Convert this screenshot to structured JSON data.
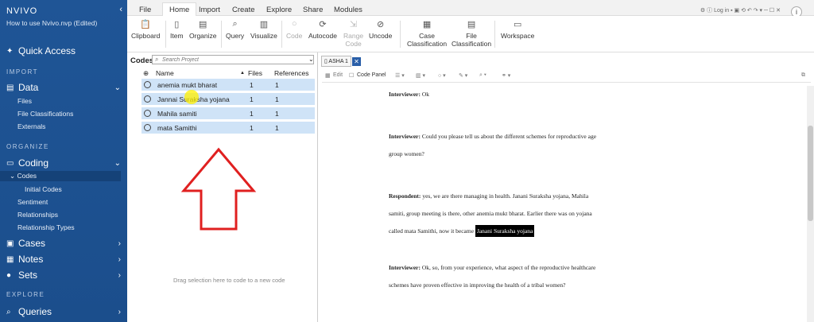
{
  "sidebar": {
    "brand": "NVIVO",
    "project": "How to use Nvivo.nvp (Edited)",
    "quick_access": "Quick Access",
    "sections": {
      "import": "IMPORT",
      "organize": "ORGANIZE",
      "explore": "EXPLORE"
    },
    "data": {
      "label": "Data",
      "items": [
        "Files",
        "File Classifications",
        "Externals"
      ]
    },
    "coding": {
      "label": "Coding",
      "codes": "Codes",
      "initial_codes": "Initial Codes",
      "items": [
        "Sentiment",
        "Relationships",
        "Relationship Types"
      ]
    },
    "cases": "Cases",
    "notes": "Notes",
    "sets": "Sets",
    "queries": "Queries"
  },
  "tabs": [
    "File",
    "Home",
    "Import",
    "Create",
    "Explore",
    "Share",
    "Modules"
  ],
  "topright": {
    "login": "Log in"
  },
  "ribbon": {
    "clipboard": "Clipboard",
    "item": "Item",
    "organize": "Organize",
    "query": "Query",
    "visualize": "Visualize",
    "code": "Code",
    "autocode": "Autocode",
    "range_code_1": "Range",
    "range_code_2": "Code",
    "uncode": "Uncode",
    "case_1": "Case",
    "case_2": "Classification",
    "file_1": "File",
    "file_2": "Classification",
    "workspace": "Workspace"
  },
  "codes_panel": {
    "title": "Codes",
    "search_placeholder": "Search Project",
    "headers": {
      "name": "Name",
      "files": "Files",
      "references": "References"
    },
    "rows": [
      {
        "name": "anemia mukt bharat",
        "files": "1",
        "refs": "1"
      },
      {
        "name": "Jannai Suraksha yojana",
        "files": "1",
        "refs": "1"
      },
      {
        "name": "Mahila samiti",
        "files": "1",
        "refs": "1"
      },
      {
        "name": "mata Samithi",
        "files": "1",
        "refs": "1"
      }
    ],
    "drag_hint": "Drag selection here to code to a new code"
  },
  "document": {
    "tab": "ASHA 1",
    "tools": {
      "edit": "Edit",
      "code_panel": "Code Panel"
    },
    "p1_speaker": "Interviewer:",
    "p1_text": " Ok",
    "p2_speaker": "Interviewer:",
    "p2_text_a": " Could you please tell us about the different schemes for reproductive age",
    "p2_text_b": "group women?",
    "p3_speaker": "Respondent:",
    "p3_text_a": " yes, we are there managing in health. Janani Suraksha yojana, Mahila",
    "p3_text_b": "samiti, group meeting is there, other anemia mukt bharat. Earlier there was on yojana",
    "p3_text_c": "called mata Samithi, now it became ",
    "p3_highlight": "Janani Suraksha yojana",
    "p4_speaker": "Interviewer:",
    "p4_text_a": " Ok, so, from your experience, what aspect of the reproductive healthcare",
    "p4_text_b": "schemes have proven effective in improving the health of a tribal women?"
  },
  "colors": {
    "sidebar": "#1f5596",
    "row_highlight": "#cfe3f7",
    "arrow": "#e02020"
  }
}
